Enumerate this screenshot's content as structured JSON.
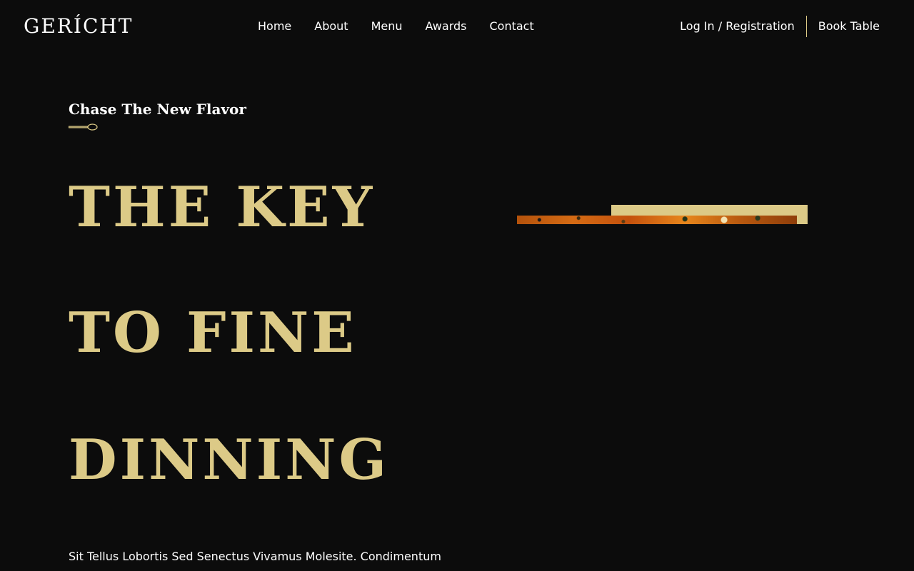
{
  "brand": {
    "logo_text": "GERÍCHT"
  },
  "nav": {
    "links": [
      {
        "label": "Home"
      },
      {
        "label": "About"
      },
      {
        "label": "Menu"
      },
      {
        "label": "Awards"
      },
      {
        "label": "Contact"
      }
    ],
    "login_label": "Log In / Registration",
    "book_label": "Book Table"
  },
  "hero": {
    "subtitle": "Chase The New Flavor",
    "headline": [
      "THE KEY",
      "TO FINE",
      "DINNING"
    ],
    "description": "Sit Tellus Lobortis Sed Senectus Vivamus Molesite. Condimentum"
  },
  "icons": {
    "divider": "spoon-icon"
  },
  "colors": {
    "background": "#0c0c0c",
    "accent_gold": "#dcca87",
    "text": "#ffffff"
  }
}
